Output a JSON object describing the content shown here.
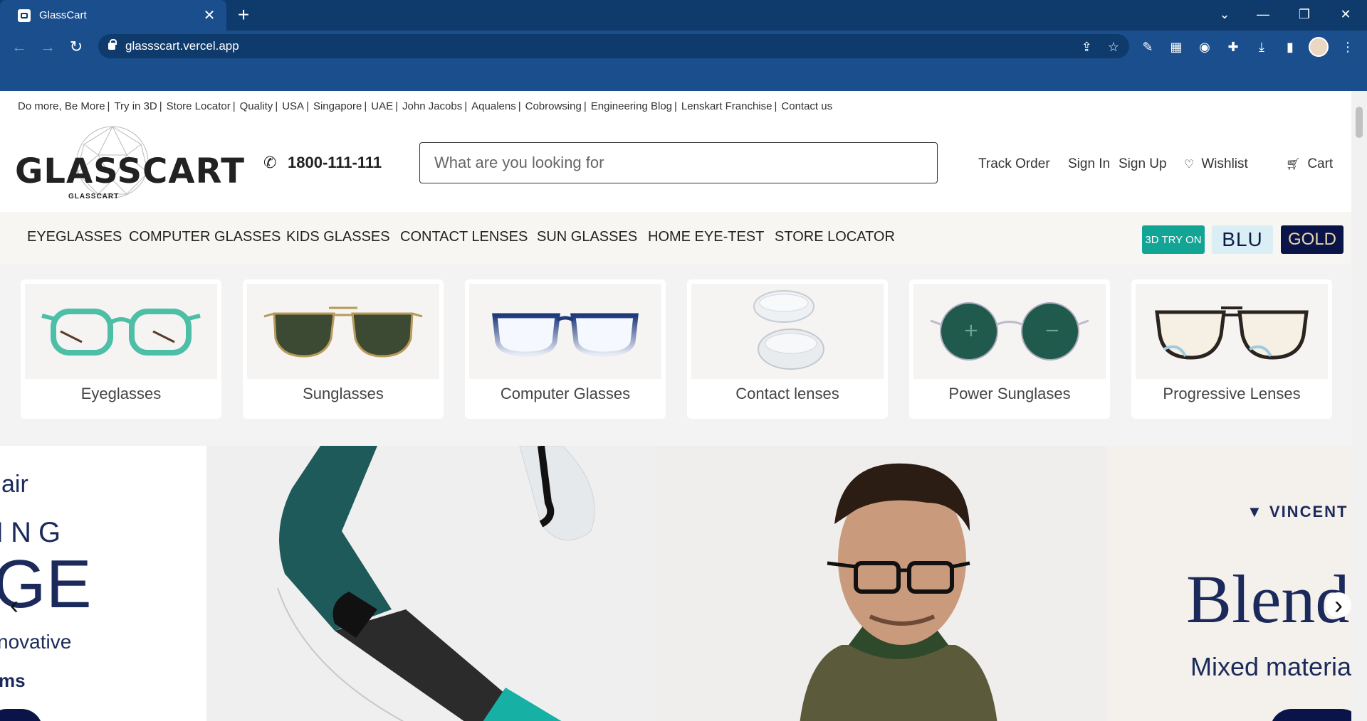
{
  "browser": {
    "tab_title": "GlassCart",
    "url": "glassscart.vercel.app"
  },
  "topbar": {
    "links": [
      "Do more, Be More",
      "Try in 3D",
      "Store Locator",
      "Quality",
      "USA",
      "Singapore",
      "UAE",
      "John Jacobs",
      "Aqualens",
      "Cobrowsing",
      "Engineering Blog",
      "Lenskart Franchise",
      "Contact us"
    ]
  },
  "header": {
    "logo_text": "GLASSCART",
    "logo_sub": "GLASSCART",
    "phone": "1800-111-111",
    "search_placeholder": "What are you looking for",
    "track_order": "Track Order",
    "sign_in": "Sign In",
    "sign_up": "Sign Up",
    "wishlist": "Wishlist",
    "cart": "Cart"
  },
  "nav": {
    "items": [
      "EYEGLASSES",
      "COMPUTER GLASSES",
      "KIDS GLASSES",
      "CONTACT LENSES",
      "SUN GLASSES",
      "HOME EYE-TEST",
      "STORE LOCATOR"
    ],
    "try_on": "3D TRY ON",
    "blu": "BLU",
    "gold": "GOLD"
  },
  "categories": [
    {
      "label": "Eyeglasses"
    },
    {
      "label": "Sunglasses"
    },
    {
      "label": "Computer Glasses"
    },
    {
      "label": "Contact lenses"
    },
    {
      "label": "Power Sunglases"
    },
    {
      "label": "Progressive Lenses"
    }
  ],
  "banner": {
    "left_line1": "air",
    "left_line2": "ING",
    "left_line3": "GE",
    "left_line4": "novative",
    "left_line5": "ms",
    "brand": "VINCENT",
    "headline": "Blend",
    "subhead": "Mixed material"
  },
  "colors": {
    "chrome_dark": "#0e3a6c",
    "chrome": "#1a4e8c",
    "teal": "#12a596",
    "navy": "#0a1448"
  }
}
